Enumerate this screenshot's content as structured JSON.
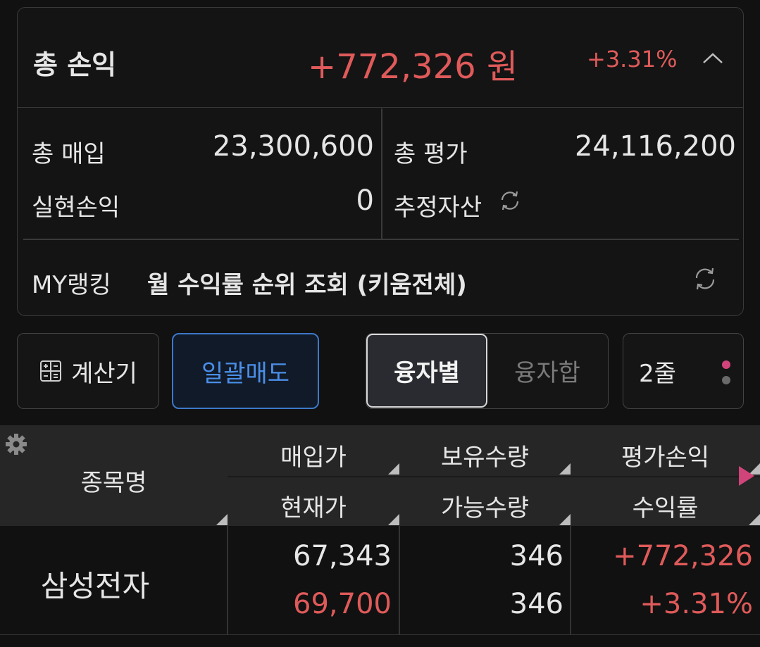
{
  "summary": {
    "title": "총 손익",
    "profit": "+772,326 원",
    "profit_rate": "+3.31%",
    "total_buy_label": "총 매입",
    "total_buy_value": "23,300,600",
    "total_eval_label": "총 평가",
    "total_eval_value": "24,116,200",
    "realized_label": "실현손익",
    "realized_value": "0",
    "estimated_label": "추정자산",
    "ranking_label": "MY랭킹",
    "ranking_text": "월 수익률 순위 조회 (키움전체)"
  },
  "toolbar": {
    "calc_label": "계산기",
    "bulk_sell_label": "일괄매도",
    "seg_on_label": "융자별",
    "seg_off_label": "융자합",
    "lines_label": "2줄"
  },
  "table": {
    "headers": {
      "name": "종목명",
      "buy_price": "매입가",
      "cur_price": "현재가",
      "hold_qty": "보유수량",
      "avail_qty": "가능수량",
      "eval_pl": "평가손익",
      "rate": "수익률"
    },
    "rows": [
      {
        "name": "삼성전자",
        "buy_price": "67,343",
        "cur_price": "69,700",
        "hold_qty": "346",
        "avail_qty": "346",
        "eval_pl": "+772,326",
        "rate": "+3.31%"
      }
    ]
  },
  "colors": {
    "profit_red": "#e05a5a",
    "accent_blue": "#4a8fe8",
    "dot_pink": "#d0447a",
    "dot_gray": "#6a6a6a"
  }
}
